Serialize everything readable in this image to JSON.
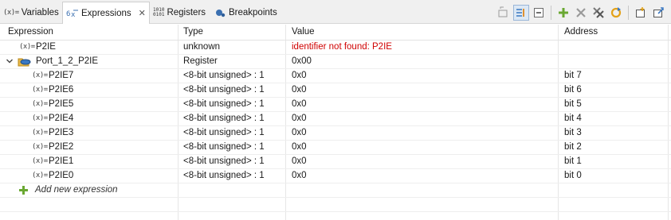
{
  "tabs": [
    {
      "label": "Variables",
      "icon": "variable-icon",
      "glyph": "(x)="
    },
    {
      "label": "Expressions",
      "icon": "expressions-icon",
      "active": true
    },
    {
      "label": "Registers",
      "icon": "registers-icon",
      "glyph_top": "1010",
      "glyph_bottom": "0101"
    },
    {
      "label": "Breakpoints",
      "icon": "breakpoints-icon"
    }
  ],
  "tab_close": "✕",
  "columns": [
    "Expression",
    "Type",
    "Value",
    "Address"
  ],
  "rows": [
    {
      "expr": "P2IE",
      "type": "unknown",
      "value": "identifier not found: P2IE",
      "address": ""
    },
    {
      "expr": "Port_1_2_P2IE",
      "type": "Register",
      "value": "0x00",
      "address": ""
    },
    {
      "expr": "P2IE7",
      "type": "<8-bit unsigned> : 1",
      "value": "0x0",
      "address": "bit 7"
    },
    {
      "expr": "P2IE6",
      "type": "<8-bit unsigned> : 1",
      "value": "0x0",
      "address": "bit 6"
    },
    {
      "expr": "P2IE5",
      "type": "<8-bit unsigned> : 1",
      "value": "0x0",
      "address": "bit 5"
    },
    {
      "expr": "P2IE4",
      "type": "<8-bit unsigned> : 1",
      "value": "0x0",
      "address": "bit 4"
    },
    {
      "expr": "P2IE3",
      "type": "<8-bit unsigned> : 1",
      "value": "0x0",
      "address": "bit 3"
    },
    {
      "expr": "P2IE2",
      "type": "<8-bit unsigned> : 1",
      "value": "0x0",
      "address": "bit 2"
    },
    {
      "expr": "P2IE1",
      "type": "<8-bit unsigned> : 1",
      "value": "0x0",
      "address": "bit 1"
    },
    {
      "expr": "P2IE0",
      "type": "<8-bit unsigned> : 1",
      "value": "0x0",
      "address": "bit 0"
    }
  ],
  "add_expression": "Add new expression",
  "colors": {
    "error": "#d00000",
    "add": "#6aa832",
    "accent": "#3a78c2"
  }
}
